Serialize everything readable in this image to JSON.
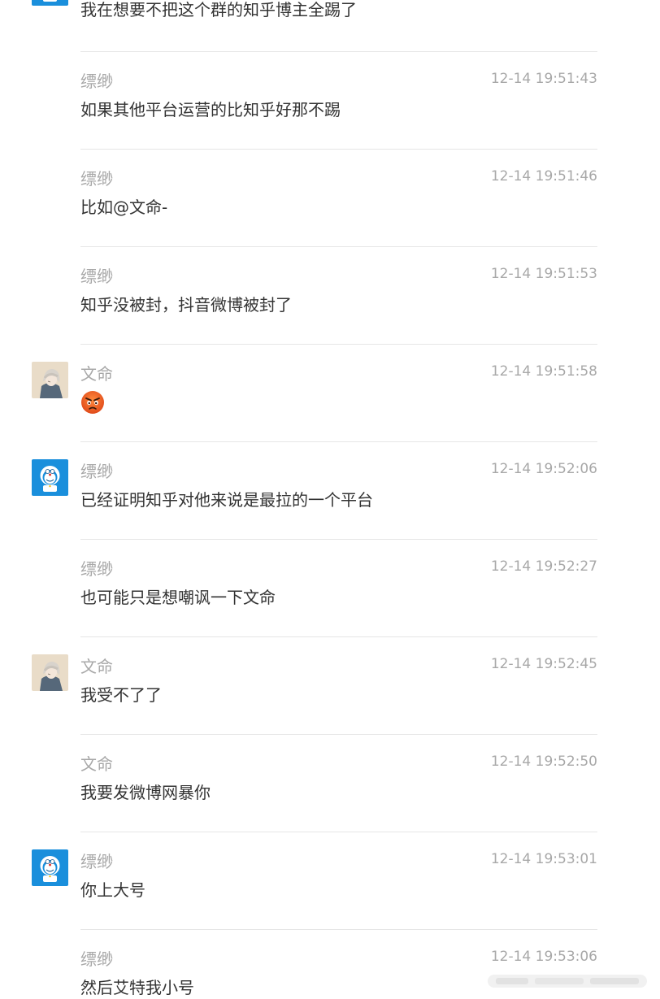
{
  "messages": [
    {
      "sender": "",
      "time": "",
      "text": "我在想要不把这个群的知乎博主全踢了",
      "avatar": "doraemon"
    },
    {
      "sender": "缥缈",
      "time": "12-14 19:51:43",
      "text": "如果其他平台运营的比知乎好那不踢",
      "avatar": ""
    },
    {
      "sender": "缥缈",
      "time": "12-14 19:51:46",
      "text": "比如@文命-",
      "avatar": ""
    },
    {
      "sender": "缥缈",
      "time": "12-14 19:51:53",
      "text": "知乎没被封，抖音微博被封了",
      "avatar": ""
    },
    {
      "sender": "文命",
      "time": "12-14 19:51:58",
      "text": "",
      "avatar": "anime",
      "emoji": "angry-face"
    },
    {
      "sender": "缥缈",
      "time": "12-14 19:52:06",
      "text": "已经证明知乎对他来说是最拉的一个平台",
      "avatar": "doraemon"
    },
    {
      "sender": "缥缈",
      "time": "12-14 19:52:27",
      "text": "也可能只是想嘲讽一下文命",
      "avatar": ""
    },
    {
      "sender": "文命",
      "time": "12-14 19:52:45",
      "text": "我受不了了",
      "avatar": "anime"
    },
    {
      "sender": "文命",
      "time": "12-14 19:52:50",
      "text": "我要发微博网暴你",
      "avatar": ""
    },
    {
      "sender": "缥缈",
      "time": "12-14 19:53:01",
      "text": "你上大号",
      "avatar": "doraemon"
    },
    {
      "sender": "缥缈",
      "time": "12-14 19:53:06",
      "text": "然后艾特我小号",
      "avatar": ""
    }
  ],
  "colors": {
    "background": "#ffffff",
    "meta_text": "#a8a8a8",
    "message_text": "#333333",
    "divider": "#e6e6e6",
    "doraemon_bg": "#1a8fdc",
    "emoji_face": "#f26b2a"
  }
}
